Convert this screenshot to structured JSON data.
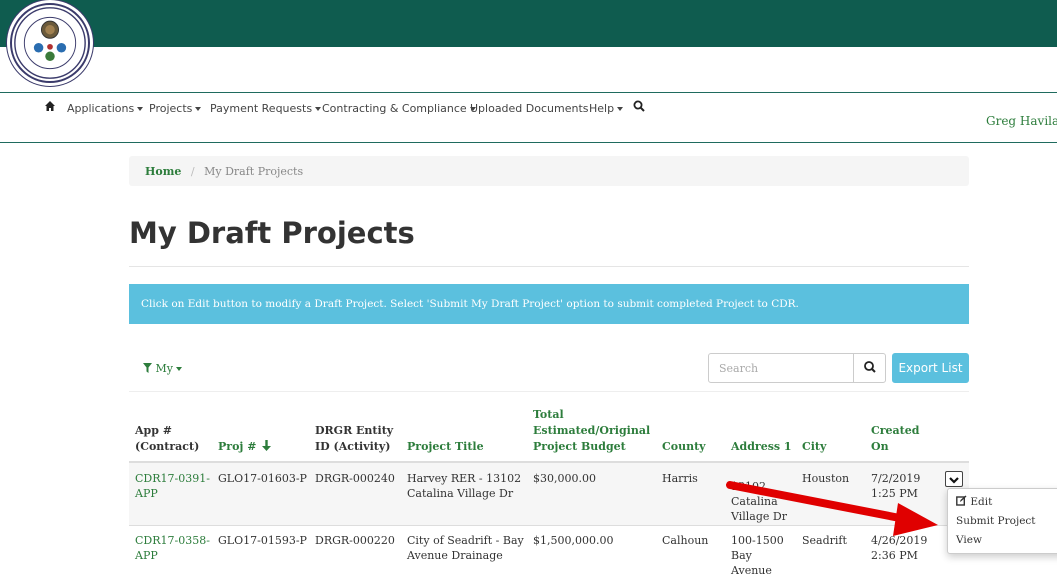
{
  "user": {
    "name": "Greg Haviland"
  },
  "nav": {
    "items": [
      {
        "label": "Applications",
        "has_caret": true
      },
      {
        "label": "Projects",
        "has_caret": true
      },
      {
        "label": "Payment Requests",
        "has_caret": true
      },
      {
        "label": "Contracting & Compliance",
        "has_caret": true
      },
      {
        "label": "Uploaded Documents",
        "has_caret": false
      },
      {
        "label": "Help",
        "has_caret": true
      }
    ]
  },
  "breadcrumb": {
    "home": "Home",
    "separator": "/",
    "current": "My Draft Projects"
  },
  "page": {
    "title": "My Draft Projects",
    "info": "Click on Edit button to modify a Draft Project. Select 'Submit My Draft Project' option to submit completed Project to CDR."
  },
  "toolbar": {
    "filter_label": "My",
    "search_placeholder": "Search",
    "export_label": "Export List"
  },
  "table": {
    "headers": {
      "app": [
        "App #",
        "(Contract)"
      ],
      "proj": "Proj #",
      "drgr": [
        "DRGR Entity",
        "ID (Activity)"
      ],
      "title": "Project Title",
      "budget": [
        "Total",
        "Estimated/Original",
        "Project Budget"
      ],
      "county": "County",
      "address": "Address 1",
      "city": "City",
      "created": [
        "Created",
        "On"
      ]
    },
    "rows": [
      {
        "app": [
          "CDR17-0391-",
          "APP"
        ],
        "proj": "GLO17-01603-P",
        "drgr": "DRGR-000240",
        "title": [
          "Harvey RER - 13102",
          "Catalina Village Dr"
        ],
        "budget": "$30,000.00",
        "county": "Harris",
        "address": [
          "13102",
          "Catalina",
          "Village Dr"
        ],
        "city": "Houston",
        "created": [
          "7/2/2019",
          "1:25 PM"
        ]
      },
      {
        "app": [
          "CDR17-0358-",
          "APP"
        ],
        "proj": "GLO17-01593-P",
        "drgr": "DRGR-000220",
        "title": [
          "City of Seadrift - Bay",
          "Avenue Drainage"
        ],
        "budget": "$1,500,000.00",
        "county": "Calhoun",
        "address": [
          "100-1500",
          "Bay",
          "Avenue"
        ],
        "city": "Seadrift",
        "created": [
          "4/26/2019",
          "2:36 PM"
        ]
      }
    ]
  },
  "row_actions": {
    "edit": "Edit",
    "submit": "Submit Project",
    "view": "View"
  },
  "colors": {
    "header_green": "#0f5c4f",
    "link_green": "#2d7d3c",
    "info_blue": "#5bc0de",
    "arrow_red": "#e00000"
  },
  "icons": [
    "home-icon",
    "search-icon",
    "filter-icon",
    "sort-down-arrow-icon",
    "chevron-down-icon",
    "edit-icon",
    "red-annotation-arrow",
    "seal-logo"
  ]
}
